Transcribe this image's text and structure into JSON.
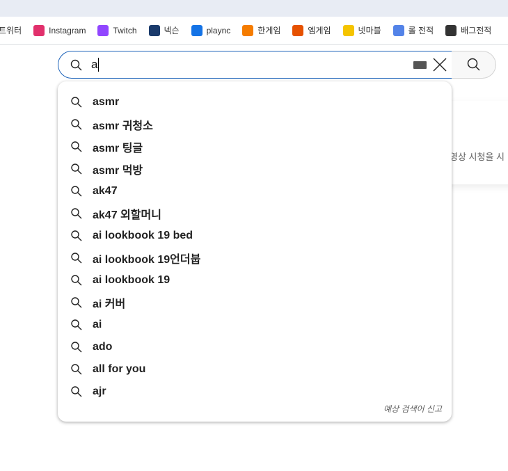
{
  "bookmarks": [
    {
      "label": "트위터",
      "icon": "twitter-icon",
      "color": ""
    },
    {
      "label": "Instagram",
      "icon": "instagram-icon",
      "color": "#e1306c"
    },
    {
      "label": "Twitch",
      "icon": "twitch-icon",
      "color": "#9146ff"
    },
    {
      "label": "넥슨",
      "icon": "nexon-icon",
      "color": "#1a3a6b"
    },
    {
      "label": "plaync",
      "icon": "plaync-icon",
      "color": "#1473e6"
    },
    {
      "label": "한게임",
      "icon": "hangame-icon",
      "color": "#f57c00"
    },
    {
      "label": "엠게임",
      "icon": "mgame-icon",
      "color": "#e65100"
    },
    {
      "label": "넷마블",
      "icon": "netmarble-icon",
      "color": "#f5c400"
    },
    {
      "label": "롤 전적",
      "icon": "opgg-icon",
      "color": "#5383e8"
    },
    {
      "label": "배그전적",
      "icon": "opgg-pubg-icon",
      "color": "#333333"
    }
  ],
  "search": {
    "value": "a"
  },
  "background_card": {
    "text": "영상 시청을 시"
  },
  "suggestions": [
    "asmr",
    "asmr 귀청소",
    "asmr 팅글",
    "asmr 먹방",
    "ak47",
    "ak47 외할머니",
    "ai lookbook 19 bed",
    "ai lookbook 19언더붑",
    "ai lookbook 19",
    "ai 커버",
    "ai",
    "ado",
    "all for you",
    "ajr"
  ],
  "report_label": "예상 검색어 신고",
  "colors": {
    "focus_border": "#1c62b9"
  }
}
